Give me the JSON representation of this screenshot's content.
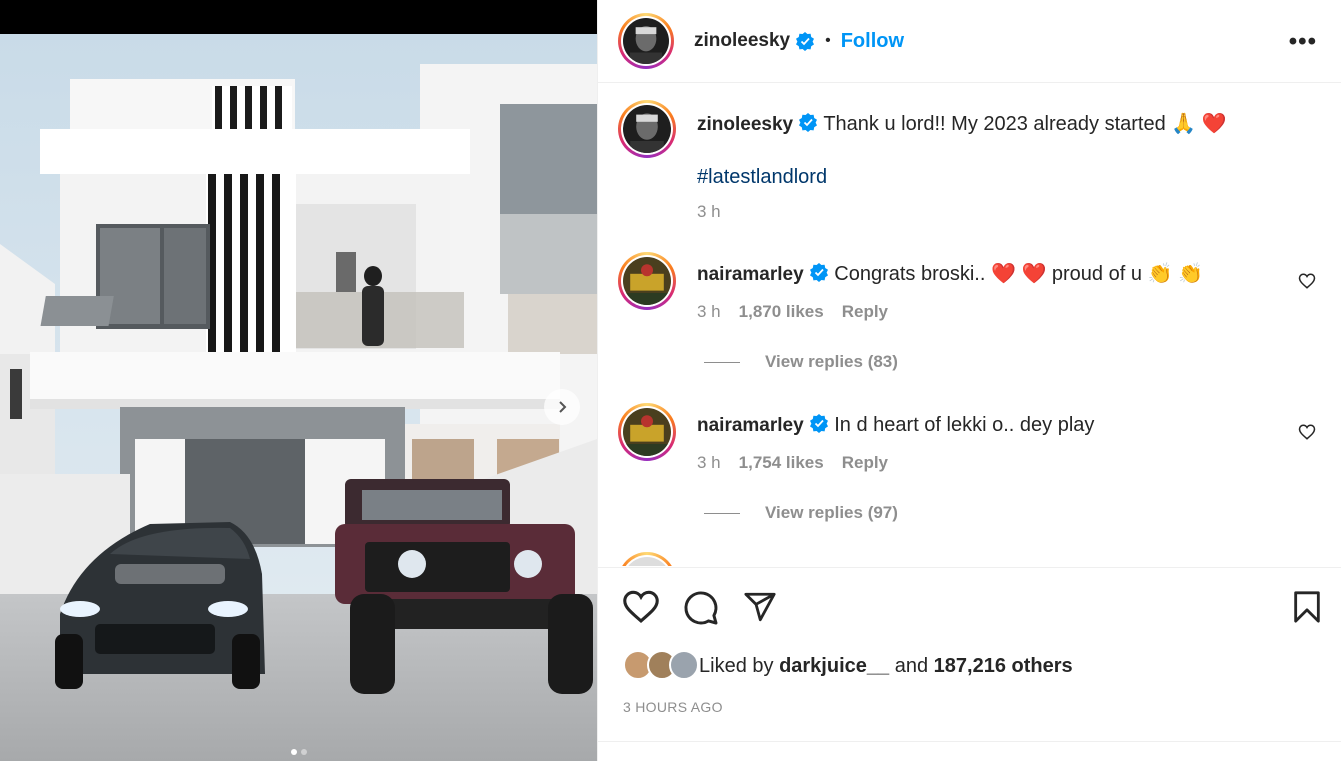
{
  "post": {
    "author": "zinoleesky",
    "follow_label": "Follow",
    "separator": "•",
    "more_label": "•••"
  },
  "caption": {
    "username": "zinoleesky",
    "text": "Thank u lord!! My 2023 already started 🙏 ❤️",
    "hashtag": "#latestlandlord",
    "time": "3 h"
  },
  "comments": [
    {
      "username": "nairamarley",
      "text": "Congrats broski.. ❤️ ❤️ proud of u 👏 👏",
      "time": "3 h",
      "likes": "1,870 likes",
      "reply_label": "Reply",
      "view_replies": "View replies (83)"
    },
    {
      "username": "nairamarley",
      "text": "In d heart of lekki o.. dey play",
      "time": "3 h",
      "likes": "1,754 likes",
      "reply_label": "Reply",
      "view_replies": "View replies (97)"
    }
  ],
  "liked_by": {
    "prefix": "Liked by",
    "user": "darkjuice__",
    "middle": "and",
    "others": "187,216 others"
  },
  "timestamp": "3 HOURS AGO",
  "icons": {
    "like": "heart-icon",
    "comment": "comment-icon",
    "share": "send-icon",
    "save": "bookmark-icon",
    "verified": "verified-badge-icon",
    "next": "chevron-right-icon"
  },
  "colors": {
    "follow": "#0095f6",
    "verified": "#0095f6",
    "hashtag": "#00376b",
    "secondary": "#8e8e8e"
  }
}
